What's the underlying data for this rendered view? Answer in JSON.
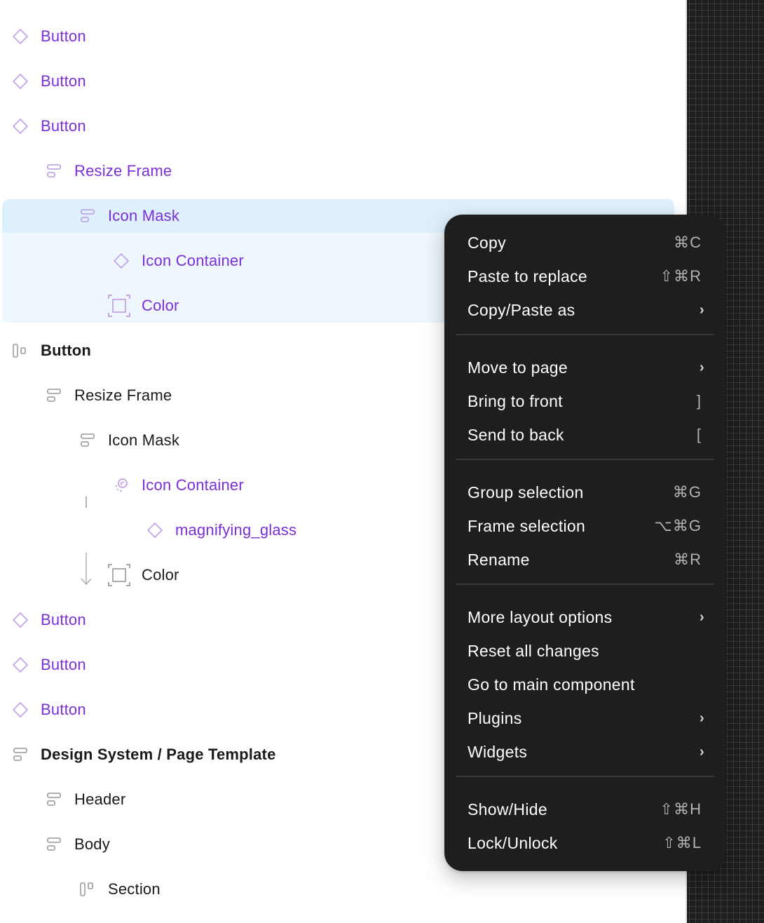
{
  "layers": [
    {
      "label": "Button",
      "icon": "component-instance-icon",
      "color": "purple",
      "bold": false
    },
    {
      "label": "Button",
      "icon": "component-instance-icon",
      "color": "purple",
      "bold": false
    },
    {
      "label": "Button",
      "icon": "component-instance-icon",
      "color": "purple",
      "bold": false
    },
    {
      "label": "Resize Frame",
      "icon": "auto-layout-vertical-icon",
      "color": "purple",
      "bold": false
    },
    {
      "label": "Icon Mask",
      "icon": "auto-layout-vertical-icon",
      "color": "purple",
      "bold": false,
      "selected": true
    },
    {
      "label": "Icon Container",
      "icon": "component-instance-icon",
      "color": "purple",
      "bold": false
    },
    {
      "label": "Color",
      "icon": "frame-bounds-icon",
      "color": "purple",
      "bold": false
    },
    {
      "label": "Button",
      "icon": "auto-layout-horizontal-icon",
      "color": "dark",
      "bold": true
    },
    {
      "label": "Resize Frame",
      "icon": "auto-layout-vertical-icon",
      "color": "dark",
      "bold": false
    },
    {
      "label": "Icon Mask",
      "icon": "auto-layout-vertical-icon",
      "color": "dark",
      "bold": false
    },
    {
      "label": "Icon Container",
      "icon": "swap-instance-icon",
      "color": "purple",
      "bold": false
    },
    {
      "label": "magnifying_glass",
      "icon": "component-instance-icon",
      "color": "purple",
      "bold": false
    },
    {
      "label": "Color",
      "icon": "frame-bounds-icon",
      "color": "dark",
      "bold": false
    },
    {
      "label": "Button",
      "icon": "component-instance-icon",
      "color": "purple",
      "bold": false
    },
    {
      "label": "Button",
      "icon": "component-instance-icon",
      "color": "purple",
      "bold": false
    },
    {
      "label": "Button",
      "icon": "component-instance-icon",
      "color": "purple",
      "bold": false
    },
    {
      "label": "Design System / Page Template",
      "icon": "auto-layout-vertical-icon",
      "color": "dark",
      "bold": true
    },
    {
      "label": "Header",
      "icon": "auto-layout-vertical-icon",
      "color": "dark",
      "bold": false
    },
    {
      "label": "Body",
      "icon": "auto-layout-vertical-icon",
      "color": "dark",
      "bold": false
    },
    {
      "label": "Section",
      "icon": "auto-layout-horizontal-top-icon",
      "color": "dark",
      "bold": false
    }
  ],
  "context_menu": {
    "groups": [
      [
        {
          "label": "Copy",
          "shortcut": "⌘C"
        },
        {
          "label": "Paste to replace",
          "shortcut": "⇧⌘R"
        },
        {
          "label": "Copy/Paste as",
          "submenu": true
        }
      ],
      [
        {
          "label": "Move to page",
          "submenu": true
        },
        {
          "label": "Bring to front",
          "shortcut": "]"
        },
        {
          "label": "Send to back",
          "shortcut": "["
        }
      ],
      [
        {
          "label": "Group selection",
          "shortcut": "⌘G"
        },
        {
          "label": "Frame selection",
          "shortcut": "⌥⌘G"
        },
        {
          "label": "Rename",
          "shortcut": "⌘R"
        }
      ],
      [
        {
          "label": "More layout options",
          "submenu": true
        },
        {
          "label": "Reset all changes"
        },
        {
          "label": "Go to main component"
        },
        {
          "label": "Plugins",
          "submenu": true
        },
        {
          "label": "Widgets",
          "submenu": true
        }
      ],
      [
        {
          "label": "Show/Hide",
          "shortcut": "⇧⌘H"
        },
        {
          "label": "Lock/Unlock",
          "shortcut": "⇧⌘L"
        }
      ]
    ],
    "chevron": "›"
  },
  "colors": {
    "accent_purple": "#7b2fd8",
    "icon_purple": "#c3a6e4",
    "icon_gray": "#a6a6a6",
    "selection_primary": "#dff0fd",
    "selection_secondary": "#eef6fe",
    "menu_bg": "#1e1e1e"
  }
}
